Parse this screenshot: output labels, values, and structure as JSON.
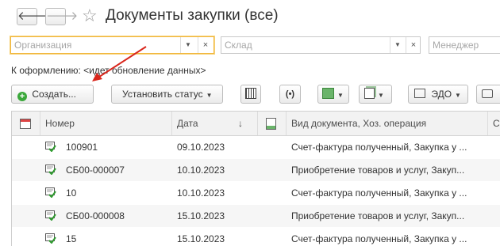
{
  "window": {
    "title": "Документы закупки (все)"
  },
  "nav": {
    "back_icon": "arrow-left-icon",
    "forward_icon": "arrow-right-icon",
    "favorite_icon": "star-icon"
  },
  "filters": {
    "organization": {
      "placeholder": "Организация"
    },
    "warehouse": {
      "placeholder": "Склад"
    },
    "manager": {
      "placeholder": "Менеджер"
    }
  },
  "status_text": "К оформлению: <идет обновление данных>",
  "toolbar": {
    "create_label": "Создать...",
    "set_status_label": "Установить статус",
    "edo_label": "ЭДО"
  },
  "table": {
    "headers": {
      "number": "Номер",
      "date": "Дата",
      "sort_indicator": "↓",
      "doc_type": "Вид документа, Хоз. операция",
      "extra": "С"
    },
    "rows": [
      {
        "number": "100901",
        "date": "09.10.2023",
        "doc_type": "Счет-фактура полученный, Закупка у ..."
      },
      {
        "number": "СБ00-000007",
        "date": "10.10.2023",
        "doc_type": "Приобретение товаров и услуг, Закуп..."
      },
      {
        "number": "10",
        "date": "10.10.2023",
        "doc_type": "Счет-фактура полученный, Закупка у ..."
      },
      {
        "number": "СБ00-000008",
        "date": "15.10.2023",
        "doc_type": "Приобретение товаров и услуг, Закуп..."
      },
      {
        "number": "15",
        "date": "15.10.2023",
        "doc_type": "Счет-фактура полученный, Закупка у ..."
      }
    ]
  },
  "colors": {
    "accent_orange": "#f1b63c",
    "arrow_red": "#d9261c",
    "create_green": "#3aa83a",
    "doc_green": "#2e9a2e"
  }
}
